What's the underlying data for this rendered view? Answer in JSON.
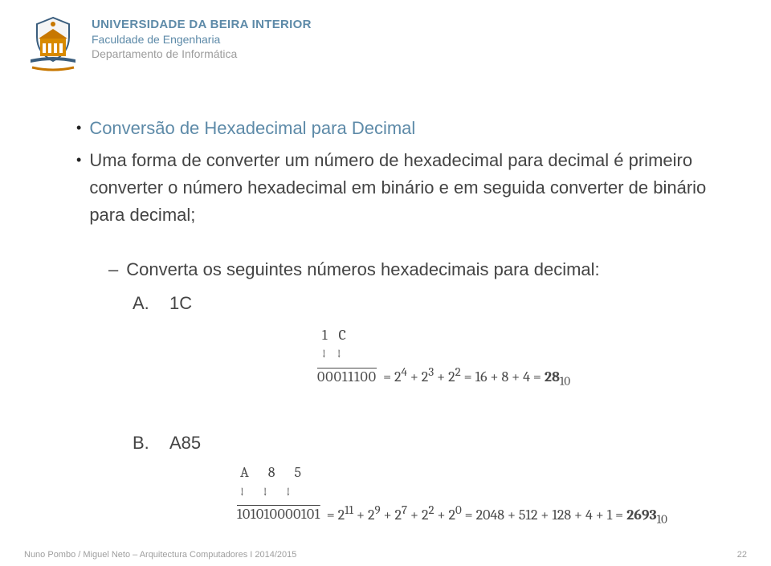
{
  "header": {
    "university": "UNIVERSIDADE DA BEIRA INTERIOR",
    "faculty": "Faculdade de Engenharia",
    "department": "Departamento de Informática"
  },
  "content": {
    "title": "Conversão de Hexadecimal para Decimal",
    "paragraph": "Uma forma de converter um número de hexadecimal para decimal é primeiro converter o número hexadecimal em binário e em seguida converter de binário para decimal;",
    "exercise_prompt": "Converta os seguintes números hexadecimais para decimal:",
    "item_a_label": "A.",
    "item_a_value": "1C",
    "math_a_digits": "1    C",
    "math_a_arrows": "↓    ↓",
    "math_a_bin": "00011100",
    "math_a_eq": "= 2⁴ + 2³ + 2² = 16 + 8 + 4 = 28₁₀",
    "item_b_label": "B.",
    "item_b_value": "A85",
    "math_b_digits": "A    8    5",
    "math_b_arrows": "↓    ↓    ↓",
    "math_b_bin": "101010000101",
    "math_b_eq": "= 2¹¹ + 2⁹ + 2⁷ + 2² + 2⁰ = 2048 + 512 + 128 + 4 + 1 = 2693₁₀"
  },
  "footer": {
    "left": "Nuno Pombo / Miguel Neto – Arquitectura Computadores I 2014/2015",
    "right": "22"
  }
}
